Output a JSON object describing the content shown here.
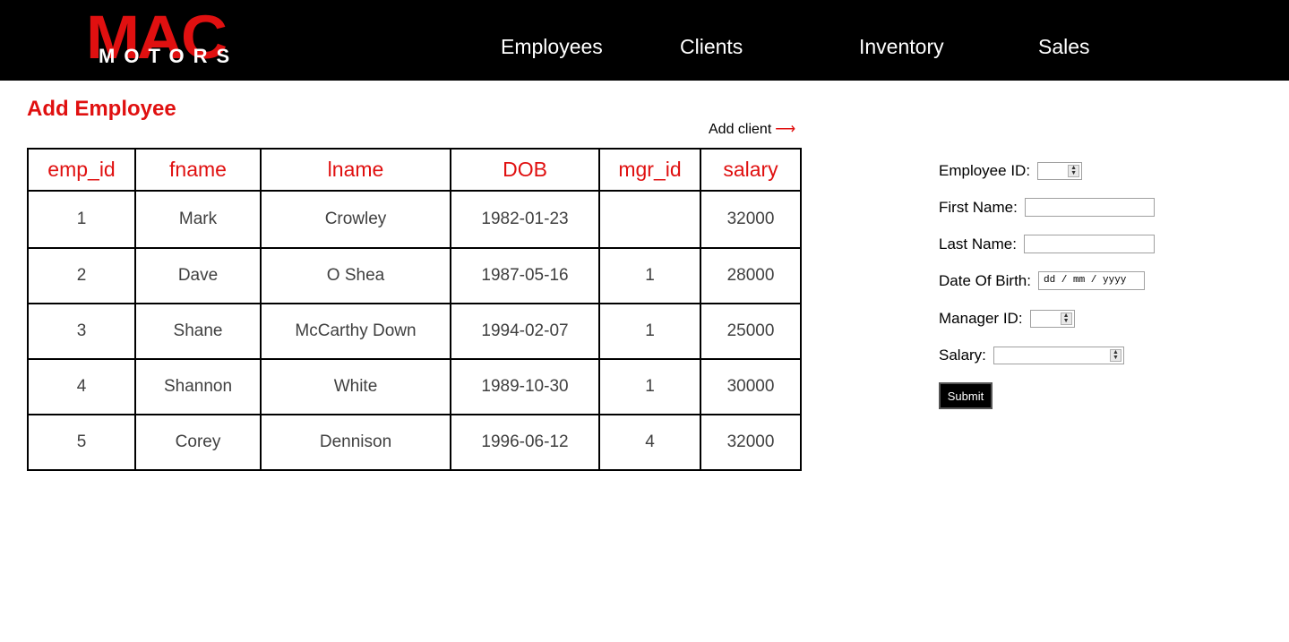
{
  "header": {
    "logo": {
      "brand": "MAC",
      "sub": "MOTORS"
    },
    "nav": [
      {
        "label": "Employees"
      },
      {
        "label": "Clients"
      },
      {
        "label": "Inventory"
      },
      {
        "label": "Sales"
      }
    ]
  },
  "main": {
    "title": "Add Employee",
    "add_client_link": "Add client",
    "add_client_arrow": "⟶",
    "table": {
      "columns": [
        "emp_id",
        "fname",
        "lname",
        "DOB",
        "mgr_id",
        "salary"
      ],
      "rows": [
        [
          "1",
          "Mark",
          "Crowley",
          "1982-01-23",
          "",
          "32000"
        ],
        [
          "2",
          "Dave",
          "O Shea",
          "1987-05-16",
          "1",
          "28000"
        ],
        [
          "3",
          "Shane",
          "McCarthy Down",
          "1994-02-07",
          "1",
          "25000"
        ],
        [
          "4",
          "Shannon",
          "White",
          "1989-10-30",
          "1",
          "30000"
        ],
        [
          "5",
          "Corey",
          "Dennison",
          "1996-06-12",
          "4",
          "32000"
        ]
      ]
    }
  },
  "form": {
    "employee_id_label": "Employee ID:",
    "first_name_label": "First Name:",
    "last_name_label": "Last Name:",
    "dob_label": "Date Of Birth:",
    "dob_placeholder": "dd / mm / yyyy",
    "manager_id_label": "Manager ID:",
    "salary_label": "Salary:",
    "submit_label": "Submit"
  },
  "colors": {
    "accent": "#e01010",
    "header_bg": "#000000"
  }
}
